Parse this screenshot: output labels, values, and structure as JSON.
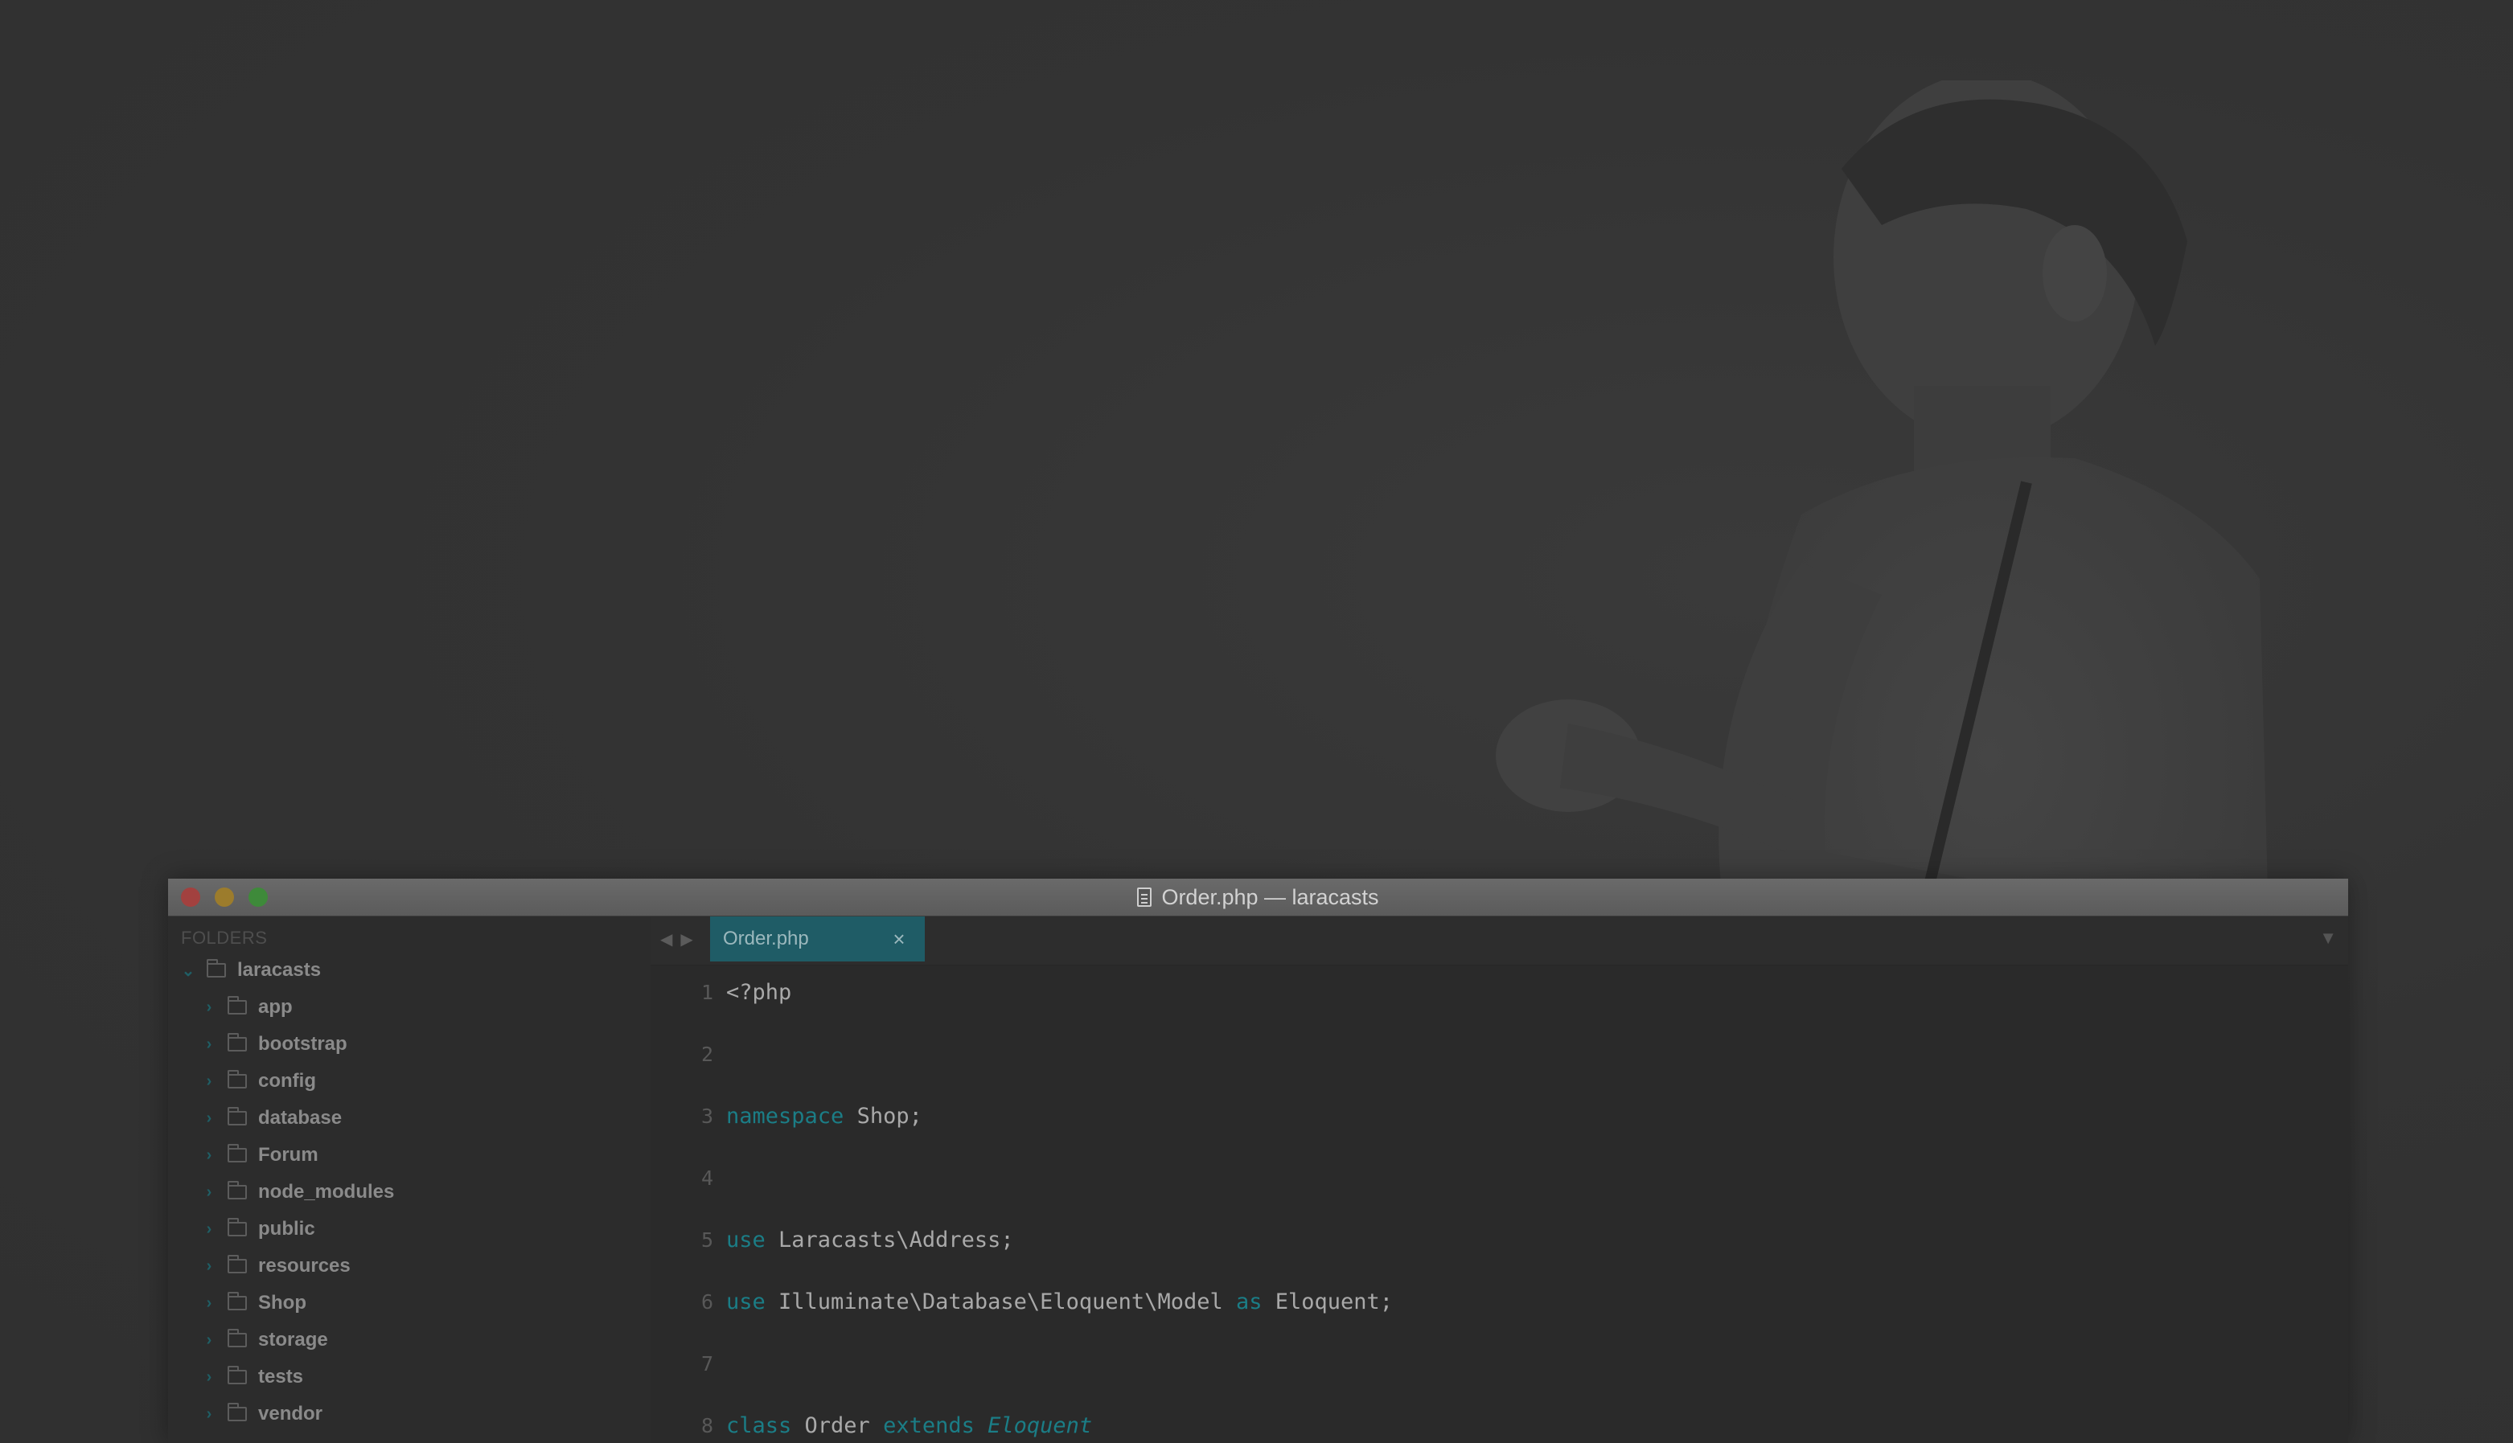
{
  "window": {
    "title": "Order.php — laracasts"
  },
  "sidebar": {
    "header": "FOLDERS",
    "root": "laracasts",
    "items": [
      "app",
      "bootstrap",
      "config",
      "database",
      "Forum",
      "node_modules",
      "public",
      "resources",
      "Shop",
      "storage",
      "tests",
      "vendor"
    ]
  },
  "tabs": {
    "active": "Order.php",
    "close_glyph": "×",
    "dropdown_glyph": "▼",
    "prev_glyph": "◀",
    "next_glyph": "▶"
  },
  "code": {
    "lines": [
      {
        "num": "1",
        "parts": [
          {
            "t": "<?php",
            "c": "plain"
          }
        ]
      },
      {
        "num": "2",
        "parts": []
      },
      {
        "num": "3",
        "parts": [
          {
            "t": "namespace",
            "c": "kw"
          },
          {
            "t": " Shop;",
            "c": "plain"
          }
        ]
      },
      {
        "num": "4",
        "parts": []
      },
      {
        "num": "5",
        "parts": [
          {
            "t": "use",
            "c": "kw"
          },
          {
            "t": " Laracasts\\Address;",
            "c": "plain"
          }
        ]
      },
      {
        "num": "6",
        "parts": [
          {
            "t": "use",
            "c": "kw"
          },
          {
            "t": " Illuminate\\Database\\Eloquent\\Model ",
            "c": "plain"
          },
          {
            "t": "as",
            "c": "kw"
          },
          {
            "t": " Eloquent;",
            "c": "plain"
          }
        ]
      },
      {
        "num": "7",
        "parts": []
      },
      {
        "num": "8",
        "parts": [
          {
            "t": "class",
            "c": "kw"
          },
          {
            "t": " Order ",
            "c": "plain"
          },
          {
            "t": "extends",
            "c": "kw"
          },
          {
            "t": " ",
            "c": "plain"
          },
          {
            "t": "Eloquent",
            "c": "italic"
          }
        ]
      }
    ]
  },
  "colors": {
    "accent": "#1f5c66",
    "keyword": "#1b7d86",
    "background": "#333333"
  },
  "icons": {
    "close": "close-icon",
    "minimize": "minimize-icon",
    "maximize": "maximize-icon",
    "file": "file-icon",
    "folder": "folder-icon",
    "chevron_right": "chevron-right-icon",
    "chevron_down": "chevron-down-icon"
  }
}
